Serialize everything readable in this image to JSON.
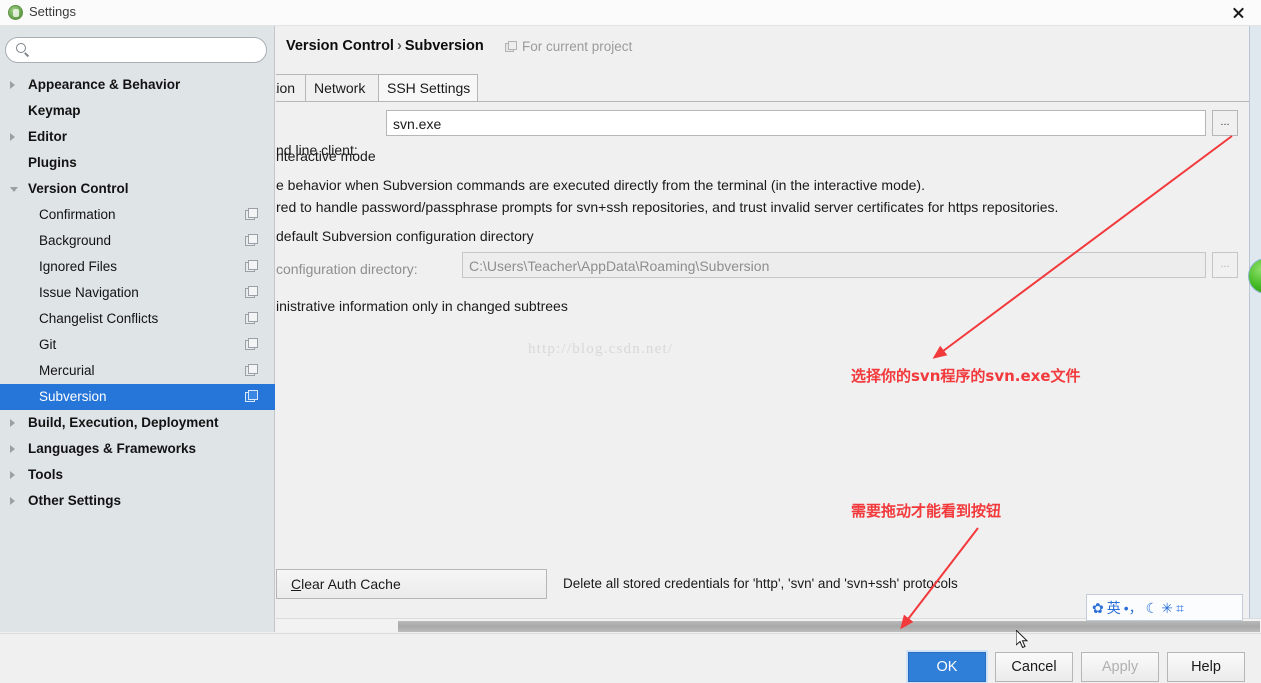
{
  "window": {
    "title": "Settings",
    "app_icon": "intellij-logo-icon",
    "close_label": "Close"
  },
  "sidebar": {
    "search": {
      "value": "",
      "placeholder": ""
    },
    "items": [
      {
        "label": "Appearance & Behavior",
        "level": "top",
        "arrow": "right",
        "scope_icon": false,
        "selected": false
      },
      {
        "label": "Keymap",
        "level": "top",
        "arrow": "none",
        "scope_icon": false,
        "selected": false
      },
      {
        "label": "Editor",
        "level": "top",
        "arrow": "right",
        "scope_icon": false,
        "selected": false
      },
      {
        "label": "Plugins",
        "level": "top",
        "arrow": "none",
        "scope_icon": false,
        "selected": false
      },
      {
        "label": "Version Control",
        "level": "top",
        "arrow": "down",
        "scope_icon": false,
        "selected": false
      },
      {
        "label": "Confirmation",
        "level": "child",
        "arrow": "none",
        "scope_icon": true,
        "selected": false
      },
      {
        "label": "Background",
        "level": "child",
        "arrow": "none",
        "scope_icon": true,
        "selected": false
      },
      {
        "label": "Ignored Files",
        "level": "child",
        "arrow": "none",
        "scope_icon": true,
        "selected": false
      },
      {
        "label": "Issue Navigation",
        "level": "child",
        "arrow": "none",
        "scope_icon": true,
        "selected": false
      },
      {
        "label": "Changelist Conflicts",
        "level": "child",
        "arrow": "none",
        "scope_icon": true,
        "selected": false
      },
      {
        "label": "Git",
        "level": "child",
        "arrow": "none",
        "scope_icon": true,
        "selected": false
      },
      {
        "label": "Mercurial",
        "level": "child",
        "arrow": "none",
        "scope_icon": true,
        "selected": false
      },
      {
        "label": "Subversion",
        "level": "child",
        "arrow": "none",
        "scope_icon": true,
        "selected": true
      },
      {
        "label": "Build, Execution, Deployment",
        "level": "top",
        "arrow": "right",
        "scope_icon": false,
        "selected": false
      },
      {
        "label": "Languages & Frameworks",
        "level": "top",
        "arrow": "right",
        "scope_icon": false,
        "selected": false
      },
      {
        "label": "Tools",
        "level": "top",
        "arrow": "right",
        "scope_icon": false,
        "selected": false
      },
      {
        "label": "Other Settings",
        "level": "top",
        "arrow": "right",
        "scope_icon": false,
        "selected": false
      }
    ]
  },
  "content": {
    "breadcrumb_parent": "Version Control",
    "breadcrumb_sep": "›",
    "breadcrumb_current": "Subversion",
    "scope_note": "For current project",
    "tabs": [
      {
        "label": "ntation",
        "active": false,
        "clipped": true
      },
      {
        "label": "Network",
        "active": false,
        "clipped": false
      },
      {
        "label": "SSH Settings",
        "active": true,
        "clipped": false
      }
    ],
    "cmdline_label": "nd line client:",
    "cmdline_value": "svn.exe",
    "cmdline_browse": "...",
    "interactive_mode_label": "nteractive mode",
    "desc_line1": "e behavior when Subversion commands are executed directly from the terminal (in the interactive mode).",
    "desc_line2": "red to handle password/passphrase prompts for svn+ssh repositories, and trust invalid server certificates for https repositories.",
    "default_config_label": "default Subversion configuration directory",
    "config_dir_label": "configuration directory:",
    "config_dir_value": "C:\\Users\\Teacher\\AppData\\Roaming\\Subversion",
    "config_dir_browse": "...",
    "admin_info_label": "inistrative information only in changed subtrees",
    "clear_auth_label_pre": "C",
    "clear_auth_label_post": "lear Auth Cache",
    "clear_auth_desc": "Delete all stored credentials for 'http', 'svn' and 'svn+ssh' protocols"
  },
  "footer": {
    "ok": "OK",
    "cancel": "Cancel",
    "apply": "Apply",
    "help": "Help"
  },
  "annotations": [
    {
      "id": "anno-svn-exe",
      "text": "选择你的svn程序的svn.exe文件"
    },
    {
      "id": "anno-drag",
      "text": "需要拖动才能看到按钮"
    }
  ],
  "watermark": "http://blog.csdn.net/",
  "ime": {
    "items": [
      {
        "name": "baidu-paw-logo-icon",
        "glyph": "✿"
      },
      {
        "name": "english-mode-icon",
        "glyph": "英"
      },
      {
        "name": "punctuation-mode-icon",
        "glyph": "•，"
      },
      {
        "name": "moon-icon",
        "glyph": "☾"
      },
      {
        "name": "user-icon",
        "glyph": "✳"
      },
      {
        "name": "apps-grid-icon",
        "glyph": "⌗"
      }
    ]
  },
  "colors": {
    "accent_blue": "#2675d8",
    "primary_button": "#2f7ed8",
    "annotation_red": "#f2393c",
    "sidebar_bg": "#dfe4e7",
    "panel_bg": "#f0f0f0"
  }
}
